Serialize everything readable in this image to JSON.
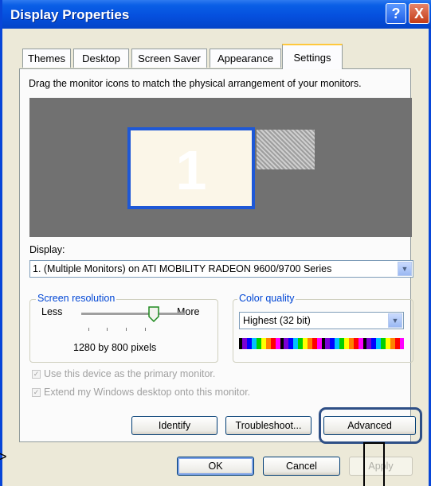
{
  "window": {
    "title": "Display Properties",
    "help_label": "?",
    "close_label": "X"
  },
  "tabs": [
    {
      "label": "Themes"
    },
    {
      "label": "Desktop"
    },
    {
      "label": "Screen Saver"
    },
    {
      "label": "Appearance"
    },
    {
      "label": "Settings",
      "active": true
    }
  ],
  "settings": {
    "instruction": "Drag the monitor icons to match the physical arrangement of your monitors.",
    "monitor1_number": "1",
    "display_label": "Display:",
    "display_value": "1. (Multiple Monitors) on ATI MOBILITY RADEON 9600/9700 Series",
    "screen_resolution": {
      "label": "Screen resolution",
      "less": "Less",
      "more": "More",
      "value": "1280 by 800 pixels"
    },
    "color_quality": {
      "label": "Color quality",
      "value": "Highest (32 bit)"
    },
    "checkboxes": [
      {
        "label": "Use this device as the primary monitor.",
        "checked": true,
        "enabled": false
      },
      {
        "label": "Extend my Windows desktop onto this monitor.",
        "checked": true,
        "enabled": false
      }
    ],
    "buttons": {
      "identify": "Identify",
      "troubleshoot": "Troubleshoot...",
      "advanced": "Advanced"
    }
  },
  "footer": {
    "ok": "OK",
    "cancel": "Cancel",
    "apply": "Apply"
  },
  "colors": {
    "titlebar": "#0550de",
    "highlight": "#2e4f86",
    "group_label": "#0046d5"
  }
}
